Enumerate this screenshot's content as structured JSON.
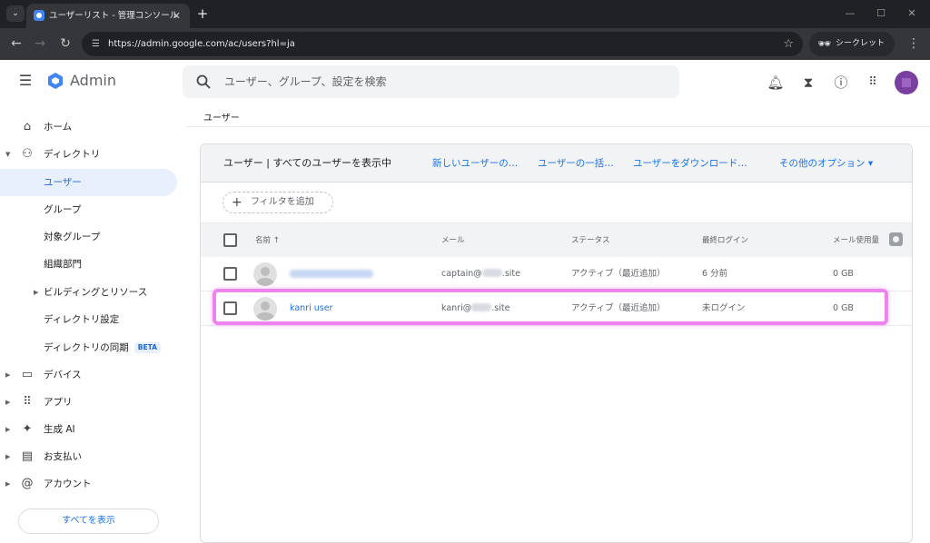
{
  "browser": {
    "tab_title": "ユーザーリスト - 管理コンソール",
    "url": "https://admin.google.com/ac/users?hl=ja",
    "incognito_label": "シークレット（2）"
  },
  "app": {
    "logo_text": "Admin",
    "search_placeholder": "ユーザー、グループ、設定を検索"
  },
  "sidebar": {
    "items": [
      {
        "label": "ホーム",
        "icon": "home-icon"
      },
      {
        "label": "ディレクトリ",
        "icon": "person-icon"
      },
      {
        "label": "ユーザー"
      },
      {
        "label": "グループ"
      },
      {
        "label": "対象グループ"
      },
      {
        "label": "組織部門"
      },
      {
        "label": "ビルディングとリソース"
      },
      {
        "label": "ディレクトリ設定"
      },
      {
        "label": "ディレクトリの同期",
        "badge": "BETA"
      },
      {
        "label": "デバイス",
        "icon": "devices-icon"
      },
      {
        "label": "アプリ",
        "icon": "apps-grid-icon"
      },
      {
        "label": "生成 AI",
        "icon": "sparkle-icon"
      },
      {
        "label": "お支払い",
        "icon": "credit-card-icon"
      },
      {
        "label": "アカウント",
        "icon": "at-sign-icon"
      }
    ],
    "show_all": "すべてを表示"
  },
  "breadcrumb": "ユーザー",
  "card": {
    "title": "ユーザー | すべてのユーザーを表示中",
    "actions": [
      "新しいユーザーの…",
      "ユーザーの一括…",
      "ユーザーをダウンロード…",
      "その他のオプション ▾"
    ],
    "filter_label": "フィルタを追加",
    "columns": [
      "名前 ↑",
      "メール",
      "ステータス",
      "最終ログイン",
      "メール使用量"
    ],
    "rows": [
      {
        "name": "",
        "email_user": "captain@",
        "email_domain": ".site",
        "status": "アクティブ（最近追加）",
        "last_login": "6 分前",
        "usage": "0 GB"
      },
      {
        "name": "kanri user",
        "email_user": "kanri@",
        "email_domain": ".site",
        "status": "アクティブ（最近追加）",
        "last_login": "未ログイン",
        "usage": "0 GB"
      }
    ]
  },
  "colors": {
    "accent": "#1a73e8",
    "highlight": "#ee82ee"
  }
}
